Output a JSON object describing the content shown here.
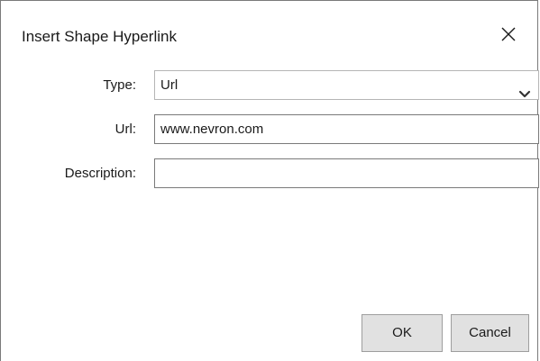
{
  "dialog": {
    "title": "Insert Shape Hyperlink",
    "close_icon": "close-icon"
  },
  "type_field": {
    "label": "Type:",
    "value": "Url",
    "chevron_icon": "chevron-down-icon"
  },
  "url_field": {
    "label": "Url:",
    "value": "www.nevron.com"
  },
  "description_field": {
    "label": "Description:",
    "value": ""
  },
  "buttons": {
    "ok_label": "OK",
    "cancel_label": "Cancel"
  }
}
